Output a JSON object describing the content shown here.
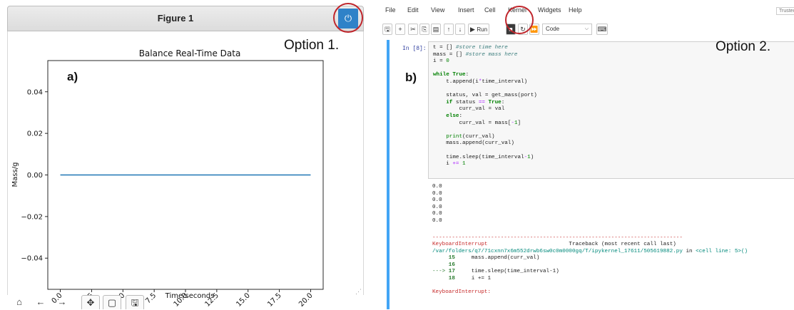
{
  "figure": {
    "window_title": "Figure 1",
    "power_icon": "power-icon",
    "option_label": "Option 1.",
    "panel_label": "a)",
    "toolbar_icons": [
      "home-icon",
      "back-arrow-icon",
      "forward-arrow-icon",
      "pan-icon",
      "zoom-rect-icon",
      "save-icon"
    ]
  },
  "notebook": {
    "menu": [
      "File",
      "Edit",
      "View",
      "Insert",
      "Cell",
      "Kernel",
      "Widgets",
      "Help"
    ],
    "trusted_label": "Trusted",
    "run_label": "Run",
    "cell_type": "Code",
    "option_label": "Option 2.",
    "panel_label": "b)",
    "in_prompt": "In [8]:",
    "output_lines": [
      "0.0",
      "0.0",
      "0.0",
      "0.0",
      "0.0",
      "0.0"
    ],
    "error_name": "KeyboardInterrupt",
    "traceback_header": "Traceback (most recent call last)",
    "traceback_path": "/var/folders/q7/71cxnn7x6m552drwb6sw0c0m0000gq/T/ipykernel_17611/505619882.py",
    "traceback_in": "in",
    "traceback_cell": "<cell line: 5>()",
    "traceback_lines": [
      {
        "marker": "",
        "num": "15",
        "code": "    mass.append(curr_val)"
      },
      {
        "marker": "",
        "num": "16",
        "code": ""
      },
      {
        "marker": "--->",
        "num": "17",
        "code": "    time.sleep(time_interval-1)"
      },
      {
        "marker": "",
        "num": "18",
        "code": "    i += 1"
      }
    ],
    "final_error": "KeyboardInterrupt:"
  },
  "chart_data": {
    "type": "line",
    "title": "Balance Real-Time Data",
    "xlabel": "Time/seconds",
    "ylabel": "Mass/g",
    "x": [
      0,
      20
    ],
    "series": [
      {
        "values": [
          0.0,
          0.0
        ]
      }
    ],
    "xlim": [
      -1,
      21
    ],
    "ylim": [
      -0.055,
      0.055
    ],
    "xticks": [
      "0.0",
      "2.5",
      "5.0",
      "7.5",
      "10.0",
      "12.5",
      "15.0",
      "17.5",
      "20.0"
    ],
    "xtick_values": [
      0,
      2.5,
      5,
      7.5,
      10,
      12.5,
      15,
      17.5,
      20
    ],
    "yticks": [
      "0.04",
      "0.02",
      "0.00",
      "−0.02",
      "−0.04"
    ],
    "ytick_values": [
      0.04,
      0.02,
      0.0,
      -0.02,
      -0.04
    ],
    "line_color": "#1f77b4",
    "grid": false
  }
}
